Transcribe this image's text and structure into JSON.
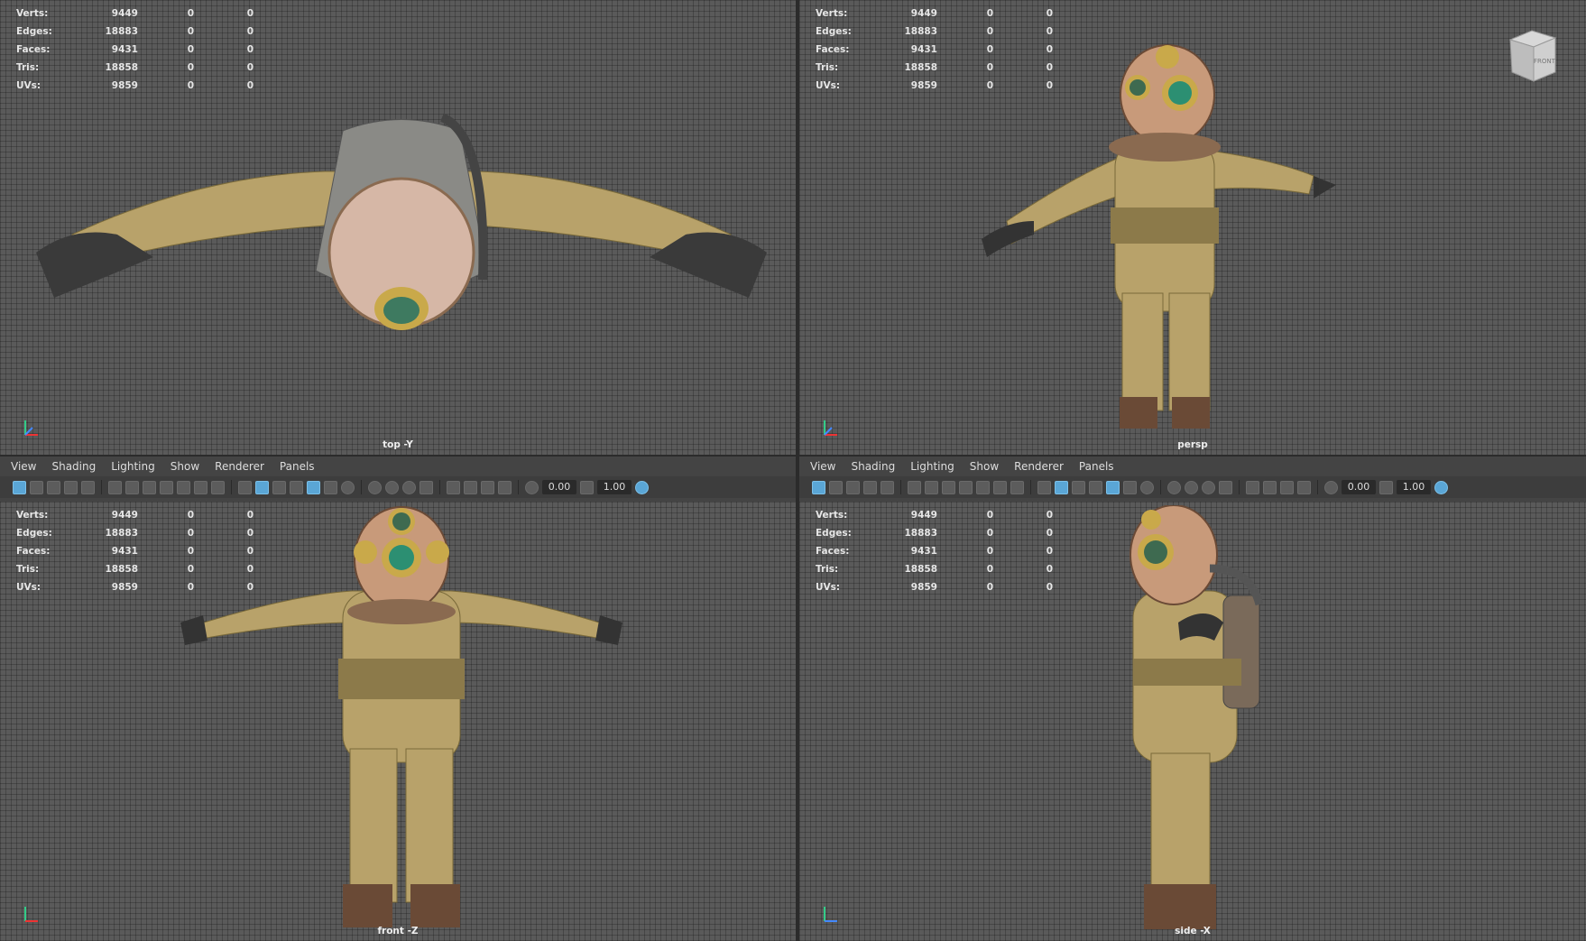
{
  "stats": {
    "rows": [
      {
        "label": "Verts:",
        "v1": "9449",
        "v2": "0",
        "v3": "0"
      },
      {
        "label": "Edges:",
        "v1": "18883",
        "v2": "0",
        "v3": "0"
      },
      {
        "label": "Faces:",
        "v1": "9431",
        "v2": "0",
        "v3": "0"
      },
      {
        "label": "Tris:",
        "v1": "18858",
        "v2": "0",
        "v3": "0"
      },
      {
        "label": "UVs:",
        "v1": "9859",
        "v2": "0",
        "v3": "0"
      }
    ]
  },
  "viewports": {
    "top": {
      "camera": "top -Y"
    },
    "persp": {
      "camera": "persp",
      "viewcube_label": "FRONT"
    },
    "front": {
      "camera": "front -Z"
    },
    "side": {
      "camera": "side -X"
    }
  },
  "panel_menu": [
    "View",
    "Shading",
    "Lighting",
    "Show",
    "Renderer",
    "Panels"
  ],
  "toolbar": {
    "field1": "0.00",
    "field2": "1.00"
  },
  "colors": {
    "viewport_bg": "#5a5a5a",
    "accent": "#5aa6d6",
    "suit": "#b8a26a",
    "helmet": "#c89a7a",
    "brass": "#c9a94a",
    "glove": "#3a3a3a"
  }
}
